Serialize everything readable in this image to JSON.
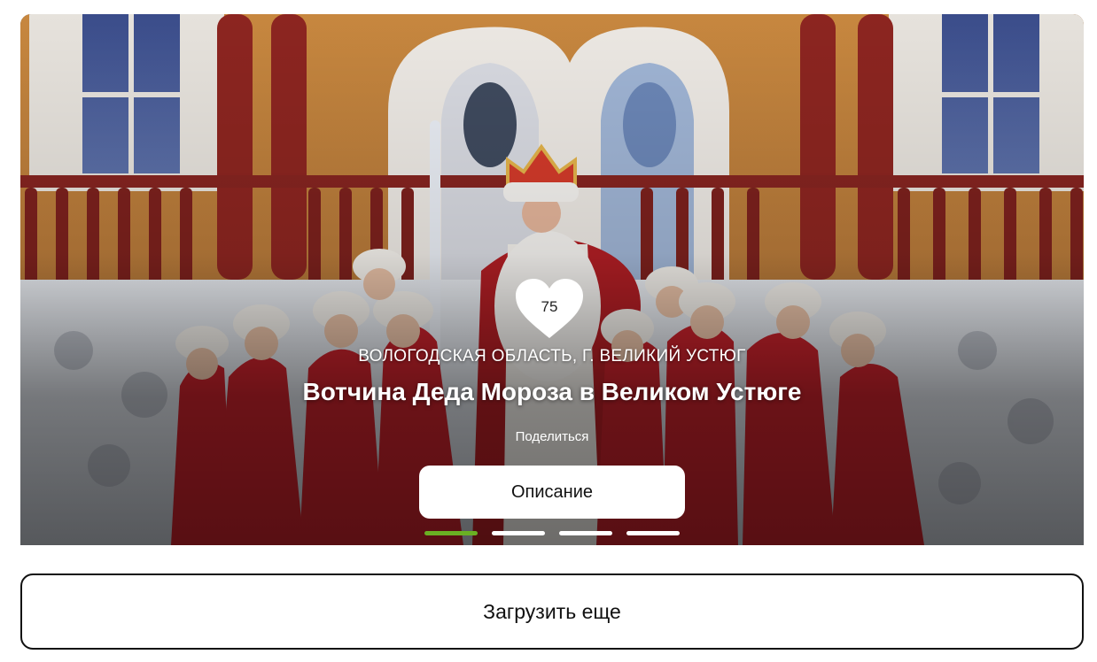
{
  "card": {
    "likes": "75",
    "region": "ВОЛОГОДСКАЯ ОБЛАСТЬ, Г. ВЕЛИКИЙ УСТЮГ",
    "title": "Вотчина Деда Мороза в Великом Устюге",
    "share_label": "Поделиться",
    "description_button": "Описание",
    "slides": {
      "count": 4,
      "active_index": 0
    },
    "icons": {
      "like": "heart-icon"
    },
    "colors": {
      "active_dot": "#6ab023",
      "inactive_dot": "#ffffff"
    }
  },
  "load_more_label": "Загрузить еще"
}
